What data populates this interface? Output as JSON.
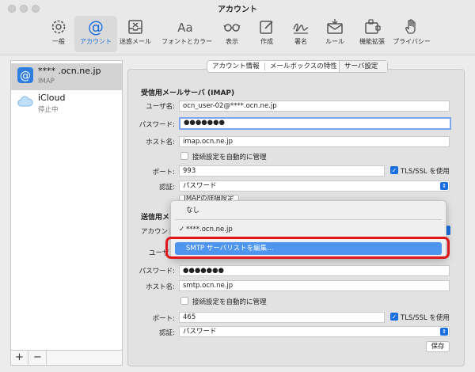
{
  "window": {
    "title": "アカウント"
  },
  "toolbar": {
    "items": [
      {
        "label": "一般",
        "icon": "gear-icon"
      },
      {
        "label": "アカウント",
        "icon": "at-icon"
      },
      {
        "label": "迷惑メール",
        "icon": "junk-tray-icon"
      },
      {
        "label": "フォントとカラー",
        "icon": "font-icon"
      },
      {
        "label": "表示",
        "icon": "glasses-icon"
      },
      {
        "label": "作成",
        "icon": "compose-icon"
      },
      {
        "label": "署名",
        "icon": "signature-icon"
      },
      {
        "label": "ルール",
        "icon": "rules-envelope-icon"
      },
      {
        "label": "機能拡張",
        "icon": "extensions-icon"
      },
      {
        "label": "プライバシー",
        "icon": "hand-icon"
      }
    ],
    "active_index": 1
  },
  "accounts": [
    {
      "name": "**** .ocn.ne.jp",
      "sub": "IMAP",
      "icon": "at-icon"
    },
    {
      "name": "iCloud",
      "sub": "停止中",
      "icon": "cloud-icon"
    }
  ],
  "list_buttons": {
    "add": "+",
    "remove": "−"
  },
  "tabs": [
    "アカウント情報",
    "メールボックスの特性",
    "サーバ設定"
  ],
  "incoming": {
    "section_title": "受信用メールサーバ (IMAP)",
    "username_label": "ユーザ名:",
    "username": "ocn_user-02@****.ocn.ne.jp",
    "password_label": "パスワード:",
    "password": "●●●●●●●",
    "host_label": "ホスト名:",
    "host": "imap.ocn.ne.jp",
    "auto_label": "接続設定を自動的に管理",
    "port_label": "ポート:",
    "port": "993",
    "tls_label": "TLS/SSL を使用",
    "auth_label": "認証:",
    "auth": "パスワード",
    "advanced_button": "IMAPの詳細設定"
  },
  "outgoing": {
    "section_title": "送信用メ",
    "account_label": "アカウント",
    "username_label": "ユーザ",
    "password_label": "パスワード:",
    "password": "●●●●●●●",
    "host_label": "ホスト名:",
    "host": "smtp.ocn.ne.jp",
    "auto_label": "接続設定を自動的に管理",
    "port_label": "ポート:",
    "port": "465",
    "tls_label": "TLS/SSL を使用",
    "auth_label": "認証:",
    "auth": "パスワード"
  },
  "dropdown": {
    "items": [
      "なし",
      "****.ocn.ne.jp",
      "SMTP サーバリストを編集..."
    ],
    "checked": "✓"
  },
  "save_button": "保存",
  "colors": {
    "accent": "#1a6fe0",
    "highlight_box": "#e0161b",
    "menu_highlight": "#4d95ee"
  }
}
